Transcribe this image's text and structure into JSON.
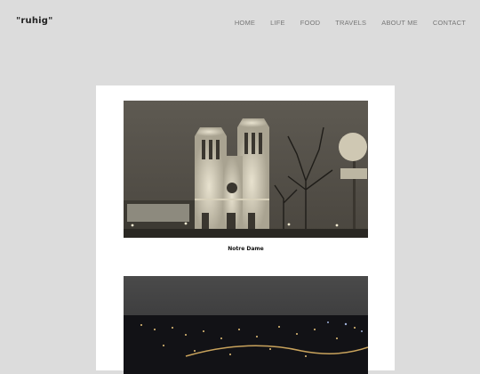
{
  "site": {
    "logo": "\"ruhig\""
  },
  "nav": {
    "items": [
      {
        "label": "HOME"
      },
      {
        "label": "LIFE"
      },
      {
        "label": "FOOD"
      },
      {
        "label": "TRAVELS"
      },
      {
        "label": "ABOUT ME"
      },
      {
        "label": "CONTACT"
      }
    ]
  },
  "post": {
    "photos": [
      {
        "caption": "Notre Dame"
      },
      {
        "caption": ""
      }
    ]
  },
  "colors": {
    "page_bg": "#dcdcdc",
    "card_bg": "#ffffff",
    "nav_text": "#777777",
    "logo_text": "#222222"
  }
}
